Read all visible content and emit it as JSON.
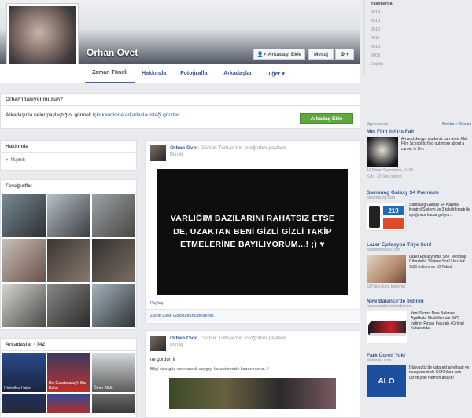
{
  "profile": {
    "name": "Orhan Ovet",
    "add_friend_label": "Arkadaşı Ekle",
    "message_label": "Mesaj",
    "more_label": "▾"
  },
  "nav": {
    "tabs": [
      "Zaman Tüneli",
      "Hakkında",
      "Fotoğraflar",
      "Arkadaşlar",
      "Diğer ▾"
    ]
  },
  "know_box": {
    "title": "Orhan'ı tanıyor musun?",
    "text_prefix": "Arkadaşınla neler paylaştığını görmek için",
    "text_link": "kendisine arkadaşlık isteği gönder.",
    "button_label": "Arkadaş Ekle"
  },
  "left": {
    "about_title": "Hakkında",
    "about_item": "Nişanlı",
    "photos_title": "Fotoğraflar",
    "friends_title": "Arkadaşlar · 742",
    "friend_captions": [
      "Hidirellez Haber",
      "Biz Galatasaray'lı Biz Baba",
      "Ömer Altıtk",
      ""
    ]
  },
  "post1": {
    "author": "Orhan Ovet",
    "action": ", Günlük Türkiye'nin fotoğrafını paylaştı.",
    "time": "Dün",
    "image_text": "VARLIĞIM BAZILARINI RAHATSIZ ETSE DE, UZAKTAN BENİ GİZLİ GİZLİ TAKİP ETMELERİNE BAYILIYORUM...! ;) ♥",
    "share_label": "Paylaş",
    "likes": "Zuhal Çelik Göksu bunu beğendi."
  },
  "post2": {
    "author": "Orhan Ovet",
    "action": ", Günlük Türkiye'nin fotoğrafını paylaştı.",
    "time": "Dün",
    "line1": "ne gordun lı",
    "line2": "Bilgi size güç verir ancak saygıyı karakterinizle kazanırsınız...!"
  },
  "right": {
    "years": [
      "Yakınlarda",
      "2014",
      "2013",
      "2012",
      "2011",
      "2010",
      "2009",
      "Doğdu"
    ],
    "sponsored_label": "Sponsorlu",
    "create_ad_label": "Reklam Oluştur",
    "ads": [
      {
        "title": "Met Film InArts Fair",
        "domain": "",
        "body": "Art and design students can meet Met Film School to find out more about a career in film",
        "meta": "12 Nisan Cumartesi, 12:00",
        "meta2": "Katıl · 23 kişi gidiyor."
      },
      {
        "title": "Samsung Galaxy S4 Premium",
        "domain": "allsamsung.com",
        "body": "Samsung Galaxy S4 Kapıda Kontrol Sistemi ve 3 taksit fırsatı ile ayağınıza kadar geliyor...",
        "meta": ""
      },
      {
        "title": "Lazer Epilasyon Tüye Son!",
        "domain": "estetikmedikal.com",
        "body": "Lazer Epilasyonda Son Teknoloji Cihazlarla Tüylere Son! Ucuzluk %50 İndirim ve 10 Taksit!",
        "meta": "537 kişi bunu beğendi."
      },
      {
        "title": "New Balance'de İndirim",
        "domain": "markalaralisveriskabi.com",
        "body": "Yeni Sezon New Balance Ayakkabı Modellerinde %70 İndirim Fırsatı Faturalı +Orjinal Kutusunda",
        "meta": ""
      },
      {
        "title": "Fark Ücreti Yok!",
        "domain": "alokarakt.com",
        "body": "Dünyagöz'de katarakt ameliyatı ve muayenesinde SGK'lılara fark ücreti yok! Hemen arayın!",
        "meta": ""
      }
    ],
    "ad_badges": [
      "219",
      "ALO"
    ]
  }
}
